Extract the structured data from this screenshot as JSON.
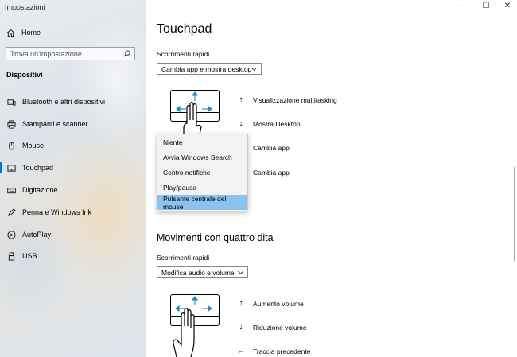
{
  "window": {
    "title": "Impostazioni",
    "controls": [
      "—",
      "☐",
      "✕"
    ]
  },
  "sidebar": {
    "home_label": "Home",
    "search_placeholder": "Trova un'impostazione",
    "section_title": "Dispositivi",
    "items": [
      {
        "label": "Bluetooth e altri dispositivi",
        "icon": "bluetooth-icon"
      },
      {
        "label": "Stampanti e scanner",
        "icon": "printer-icon"
      },
      {
        "label": "Mouse",
        "icon": "mouse-icon"
      },
      {
        "label": "Touchpad",
        "icon": "touchpad-icon",
        "active": true
      },
      {
        "label": "Digitazione",
        "icon": "keyboard-icon"
      },
      {
        "label": "Penna e Windows Ink",
        "icon": "pen-icon"
      },
      {
        "label": "AutoPlay",
        "icon": "autoplay-icon"
      },
      {
        "label": "USB",
        "icon": "usb-icon"
      }
    ]
  },
  "main": {
    "title": "Touchpad",
    "three_finger": {
      "swipes_label": "Scorrimenti rapidi",
      "swipes_value": "Cambia app e mostra desktop",
      "gestures": [
        {
          "arrow": "↑",
          "label": "Visualizzazione multitasking"
        },
        {
          "arrow": "↓",
          "label": "Mostra Desktop"
        },
        {
          "arrow": "←",
          "label": "Cambia app"
        },
        {
          "arrow": "→",
          "label": "Cambia app"
        }
      ]
    },
    "tap_menu": {
      "options": [
        "Niente",
        "Avvia Windows Search",
        "Centro notifiche",
        "Play/pausa",
        "Pulsante centrale del mouse"
      ],
      "selected": "Pulsante centrale del mouse"
    },
    "four_finger": {
      "title": "Movimenti con quattro dita",
      "swipes_label": "Scorrimenti rapidi",
      "swipes_value": "Modifica audio e volume",
      "gestures": [
        {
          "arrow": "↑",
          "label": "Aumento volume"
        },
        {
          "arrow": "↓",
          "label": "Riduzione volume"
        },
        {
          "arrow": "←",
          "label": "Traccia precedente"
        }
      ]
    }
  },
  "colors": {
    "accent": "#0078d7",
    "menu_highlight": "#8cc2ee",
    "gesture_arrows": "#1e88c8"
  }
}
